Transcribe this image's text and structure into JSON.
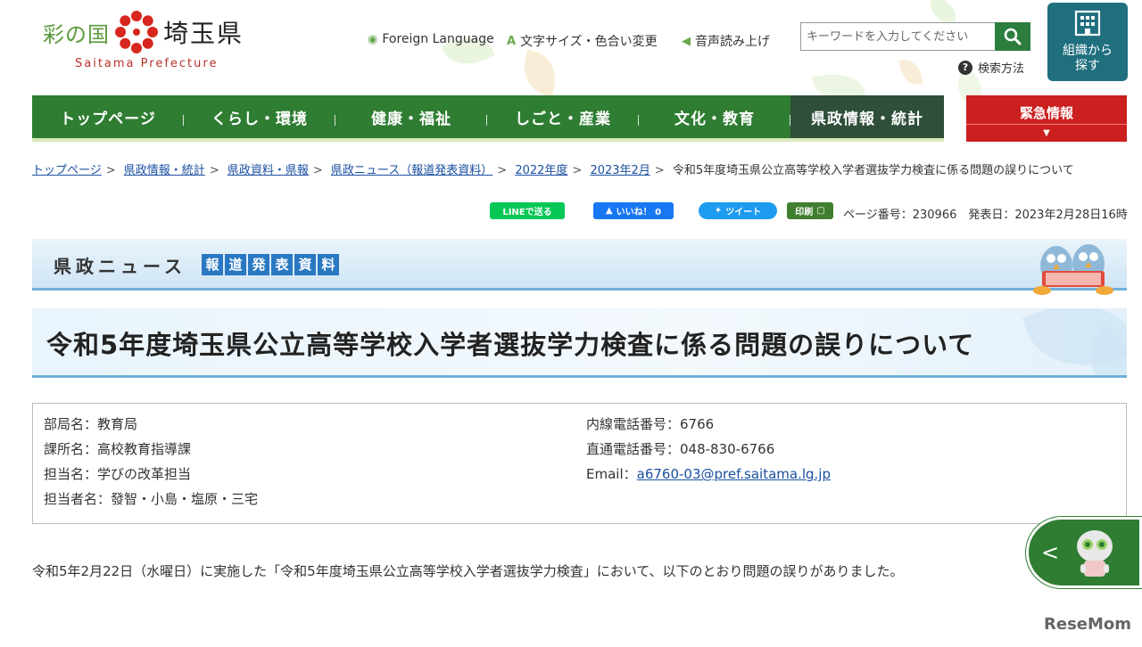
{
  "header": {
    "logo_left": "彩の国",
    "logo_right": "埼玉県",
    "logo_en": "Saitama Prefecture",
    "utils": [
      "Foreign Language",
      "文字サイズ・色合い変更",
      "音声読み上げ"
    ],
    "search_placeholder": "キーワードを入力してください",
    "search_help": "検索方法",
    "org_button_line1": "組織から",
    "org_button_line2": "探す"
  },
  "nav": {
    "items": [
      "トップページ",
      "くらし・環境",
      "健康・福祉",
      "しごと・産業",
      "文化・教育",
      "県政情報・統計"
    ],
    "active_index": 5,
    "urgent": "緊急情報"
  },
  "breadcrumb": {
    "links": [
      "トップページ",
      "県政情報・統計",
      "県政資料・県報",
      "県政ニュース（報道発表資料）",
      "2022年度",
      "2023年2月"
    ],
    "current": "令和5年度埼玉県公立高等学校入学者選抜学力検査に係る問題の誤りについて"
  },
  "share": {
    "line": "LINEで送る",
    "facebook": "いいね！ 0",
    "twitter": "ツイート",
    "print": "印刷",
    "page_info": "ページ番号：230966　発表日：2023年2月28日16時"
  },
  "banner": {
    "title": "県政ニュース",
    "tags": [
      "報",
      "道",
      "発",
      "表",
      "資",
      "料"
    ]
  },
  "page_title": "令和5年度埼玉県公立高等学校入学者選抜学力検査に係る問題の誤りについて",
  "info": {
    "bureau": "部局名：教育局",
    "section": "課所名：高校教育指導課",
    "unit": "担当名：学びの改革担当",
    "staff": "担当者名：發智・小島・塩原・三宅",
    "ext": "内線電話番号：6766",
    "direct": "直通電話番号：048-830-6766",
    "email_label": "Email：",
    "email": "a6760-03@pref.saitama.lg.jp"
  },
  "body": "令和5年2月22日（水曜日）に実施した「令和5年度埼玉県公立高等学校入学者選抜学力検査」において、以下のとおり問題の誤りがありました。",
  "watermark": "ReseMom",
  "colors": {
    "nav_green": "#2e7d32",
    "nav_active": "#2f4f3a",
    "urgent_red": "#cc1f1f",
    "org_teal": "#1f6f7e",
    "link_blue": "#1a4fa0"
  }
}
